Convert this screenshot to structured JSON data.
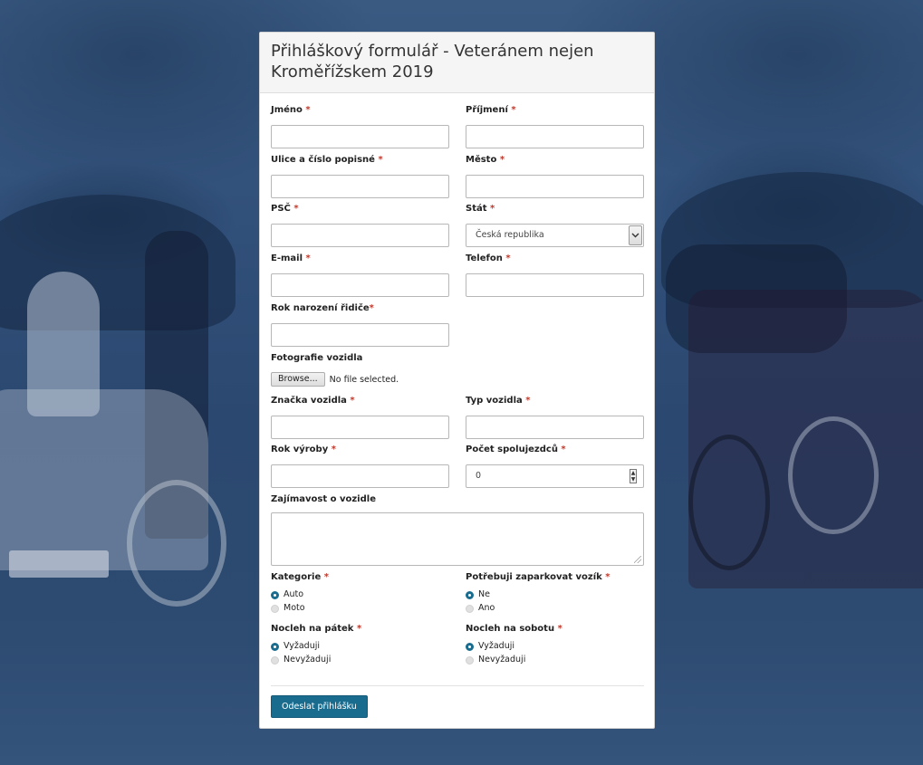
{
  "form": {
    "title": "Přihláškový formulář - Veteránem nejen Kroměřížskem 2019",
    "required_mark": "*",
    "fields": {
      "jmeno": {
        "label": "Jméno",
        "value": ""
      },
      "prijmeni": {
        "label": "Příjmení",
        "value": ""
      },
      "ulice": {
        "label": "Ulice a číslo popisné",
        "value": ""
      },
      "mesto": {
        "label": "Město",
        "value": ""
      },
      "psc": {
        "label": "PSČ",
        "value": ""
      },
      "stat": {
        "label": "Stát",
        "value": "Česká republika"
      },
      "email": {
        "label": "E-mail",
        "value": ""
      },
      "telefon": {
        "label": "Telefon",
        "value": ""
      },
      "rok_narozeni": {
        "label": "Rok narození řidiče",
        "value": ""
      },
      "fotografie": {
        "label": "Fotografie vozidla",
        "button": "Browse...",
        "status": "No file selected."
      },
      "znacka": {
        "label": "Značka vozidla",
        "value": ""
      },
      "typ": {
        "label": "Typ vozidla",
        "value": ""
      },
      "rok_vyroby": {
        "label": "Rok výroby",
        "value": ""
      },
      "pocet_spolujezdcu": {
        "label": "Počet spolujezdců",
        "value": "0"
      },
      "zajimavost": {
        "label": "Zajímavost o vozidle",
        "value": ""
      }
    },
    "radios": {
      "kategorie": {
        "label": "Kategorie",
        "options": [
          "Auto",
          "Moto"
        ],
        "selected": "Auto"
      },
      "parkovani": {
        "label": "Potřebuji zaparkovat vozík",
        "options": [
          "Ne",
          "Ano"
        ],
        "selected": "Ne"
      },
      "nocleh_patek": {
        "label": "Nocleh na pátek",
        "options": [
          "Vyžaduji",
          "Nevyžaduji"
        ],
        "selected": "Vyžaduji"
      },
      "nocleh_sobota": {
        "label": "Nocleh na sobotu",
        "options": [
          "Vyžaduji",
          "Nevyžaduji"
        ],
        "selected": "Vyžaduji"
      }
    },
    "submit_label": "Odeslat přihlášku"
  },
  "colors": {
    "accent": "#1a6c8f",
    "required": "#c0392b",
    "background_tint": "#2f4d74"
  },
  "icons": {
    "select_arrow": "chevron-down-icon",
    "spinner": "spinner-arrows-icon",
    "resize": "resize-grip-icon"
  }
}
